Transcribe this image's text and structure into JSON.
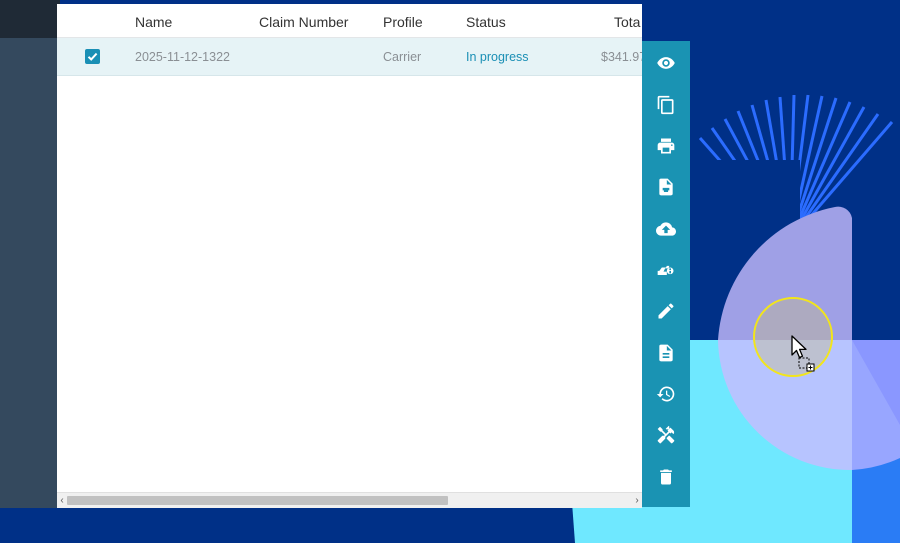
{
  "table": {
    "columns": [
      "Name",
      "Claim Number",
      "Profile",
      "Status",
      "Tota"
    ],
    "rows": [
      {
        "selected": true,
        "name": "2025-11-12-1322",
        "claim_number": "",
        "profile": "Carrier",
        "status": "In progress",
        "total": "$341.97"
      }
    ]
  },
  "scrollbar": {
    "left_arrow": "‹",
    "right_arrow": "›"
  },
  "toolbar": {
    "items": [
      {
        "icon": "eye-icon"
      },
      {
        "icon": "copy-icon"
      },
      {
        "icon": "print-icon"
      },
      {
        "icon": "print-document-icon"
      },
      {
        "icon": "cloud-upload-icon"
      },
      {
        "icon": "export-icon"
      },
      {
        "icon": "pencil-icon"
      },
      {
        "icon": "document-icon"
      },
      {
        "icon": "history-icon"
      },
      {
        "icon": "tools-icon"
      },
      {
        "icon": "trash-icon"
      }
    ]
  },
  "colors": {
    "accent": "#1a93b3",
    "background_navy": "#003087",
    "sidebar": "#34495e",
    "status_text": "#1a8fb5",
    "selected_row": "#e6f3f6",
    "cursor_highlight": "#f2e51b"
  }
}
